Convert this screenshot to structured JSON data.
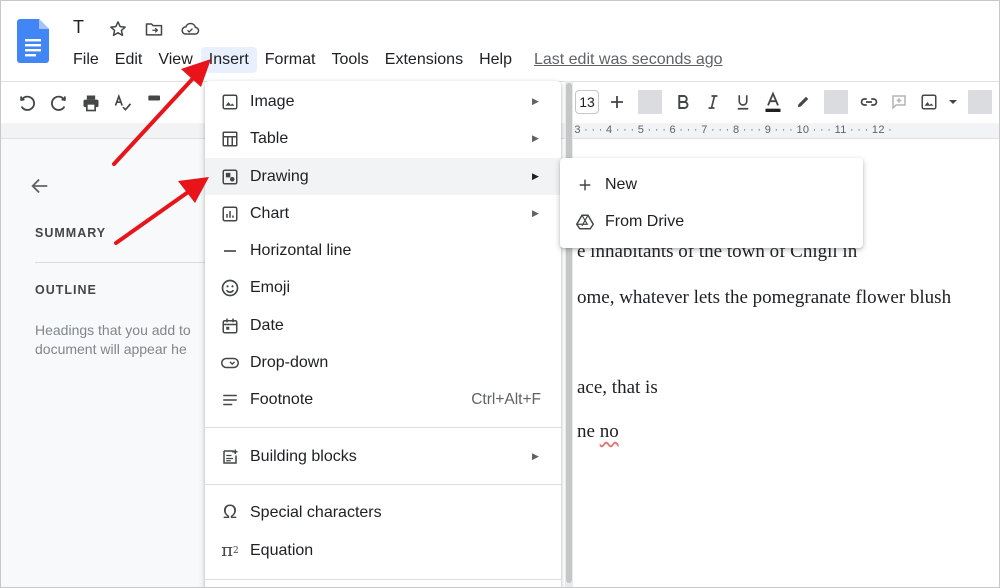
{
  "app": {
    "title": "T",
    "icons": [
      "docs-logo-icon",
      "star-icon",
      "move-folder-icon",
      "cloud-status-icon"
    ]
  },
  "menubar": {
    "items": [
      "File",
      "Edit",
      "View",
      "Insert",
      "Format",
      "Tools",
      "Extensions",
      "Help"
    ],
    "active": "Insert",
    "last_edit": "Last edit was seconds ago"
  },
  "toolbar": {
    "font_size": "13",
    "ruler": "· 3 · · · 4 · · · 5 · · · 6 · · · 7 · · · 8 · · · 9 · · · 10 · · · 11 · · · 12 ·",
    "icons": [
      "undo-icon",
      "redo-icon",
      "print-icon",
      "spellcheck-icon",
      "paint-format-icon",
      "plus-icon",
      "bold-icon",
      "italic-icon",
      "underline-icon",
      "text-color-icon",
      "highlight-icon",
      "link-icon",
      "add-comment-icon",
      "insert-image-icon",
      "align-icon"
    ]
  },
  "outline": {
    "summary_label": "SUMMARY",
    "outline_label": "OUTLINE",
    "hint_line1": "Headings that you add to",
    "hint_line2": "document will appear he"
  },
  "document": {
    "line1": "e inhabitants of the town of Chigil in",
    "line2": "ome, whatever lets the pomegranate flower blush",
    "line3": "ace, that is",
    "line4_prefix": "ne ",
    "line4_word": "no"
  },
  "insert_menu": {
    "items": [
      {
        "label": "Image",
        "icon": "image-icon",
        "submenu": true
      },
      {
        "label": "Table",
        "icon": "table-icon",
        "submenu": true
      },
      {
        "label": "Drawing",
        "icon": "drawing-icon",
        "submenu": true,
        "highlighted": true
      },
      {
        "label": "Chart",
        "icon": "chart-icon",
        "submenu": true
      },
      {
        "label": "Horizontal line",
        "icon": "horizontal-line-icon"
      },
      {
        "label": "Emoji",
        "icon": "emoji-icon"
      },
      {
        "label": "Date",
        "icon": "date-icon"
      },
      {
        "label": "Drop-down",
        "icon": "dropdown-chip-icon"
      },
      {
        "label": "Footnote",
        "icon": "footnote-icon",
        "shortcut": "Ctrl+Alt+F"
      },
      {
        "label": "Building blocks",
        "icon": "building-blocks-icon",
        "submenu": true
      },
      {
        "label": "Special characters",
        "icon": "omega-icon"
      },
      {
        "label": "Equation",
        "icon": "pi-icon"
      }
    ]
  },
  "drawing_submenu": {
    "items": [
      {
        "label": "New",
        "icon": "plus-icon"
      },
      {
        "label": "From Drive",
        "icon": "drive-icon"
      }
    ]
  },
  "colors": {
    "annotation_arrow": "#e8141a",
    "menu_highlight": "#f1f3f4",
    "active_menu": "#e8f0fe",
    "docs_blue": "#4285f4"
  }
}
